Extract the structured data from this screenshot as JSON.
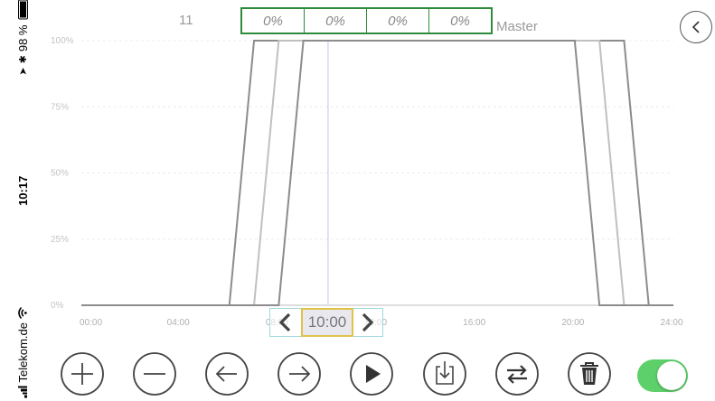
{
  "status_bar": {
    "carrier": "Telekom.de",
    "time": "10:17",
    "battery": "98 %",
    "battery_level": 0.98
  },
  "header": {
    "channel": "11",
    "master_label": "Master",
    "percentages": [
      "0%",
      "0%",
      "0%",
      "0%"
    ]
  },
  "chart_data": {
    "type": "line",
    "xlabel": "",
    "ylabel": "",
    "x_tick_labels": [
      "00:00",
      "04:00",
      "08:00",
      "12:00",
      "16:00",
      "20:00",
      "24:00"
    ],
    "y_tick_labels": [
      "0%",
      "25%",
      "50%",
      "75%",
      "100%"
    ],
    "xlim": [
      0,
      24
    ],
    "ylim": [
      0,
      100
    ],
    "grid": true,
    "cursor_time": 10.0,
    "series": [
      {
        "color": "#8c8c8c",
        "x": [
          0,
          6.0,
          7.0,
          22.0,
          23.0,
          24
        ],
        "y": [
          0,
          0,
          100,
          100,
          0,
          0
        ]
      },
      {
        "color": "#c0c0c0",
        "x": [
          0,
          7.0,
          8.0,
          21.0,
          22.0,
          24
        ],
        "y": [
          0,
          0,
          100,
          100,
          0,
          0
        ]
      },
      {
        "color": "#8c8c8c",
        "x": [
          0,
          8.0,
          9.0,
          20.0,
          21.0,
          24
        ],
        "y": [
          0,
          0,
          100,
          100,
          0,
          0
        ]
      }
    ]
  },
  "time_selector": {
    "value": "10:00"
  },
  "toolbar": [
    {
      "icon": "plus-icon"
    },
    {
      "icon": "minus-icon"
    },
    {
      "icon": "arrow-left-icon"
    },
    {
      "icon": "arrow-right-icon"
    },
    {
      "icon": "play-icon"
    },
    {
      "icon": "download-icon"
    },
    {
      "icon": "swap-icon"
    },
    {
      "icon": "trash-icon"
    }
  ],
  "enabled": true
}
